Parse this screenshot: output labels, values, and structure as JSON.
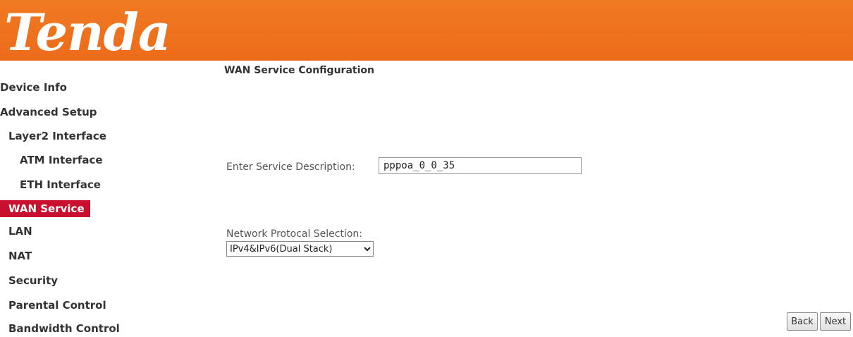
{
  "brand": {
    "logo_text": "Tenda"
  },
  "sidebar": {
    "items": [
      {
        "label": "Device Info"
      },
      {
        "label": "Advanced Setup"
      },
      {
        "label": "Layer2 Interface"
      },
      {
        "label": "ATM Interface"
      },
      {
        "label": "ETH Interface"
      },
      {
        "label": "WAN Service",
        "active": true
      },
      {
        "label": "LAN"
      },
      {
        "label": "NAT"
      },
      {
        "label": "Security"
      },
      {
        "label": "Parental Control"
      },
      {
        "label": "Bandwidth Control"
      }
    ]
  },
  "main": {
    "title": "WAN Service Configuration",
    "service_description": {
      "label": "Enter Service Description:",
      "value": "pppoa_0_0_35"
    },
    "protocol": {
      "label": "Network Protocal Selection:",
      "selected": "IPv4&IPv6(Dual Stack)"
    },
    "buttons": {
      "back": "Back",
      "next": "Next"
    }
  },
  "colors": {
    "header": "#ec6b1a",
    "active_nav": "#c8102e"
  }
}
